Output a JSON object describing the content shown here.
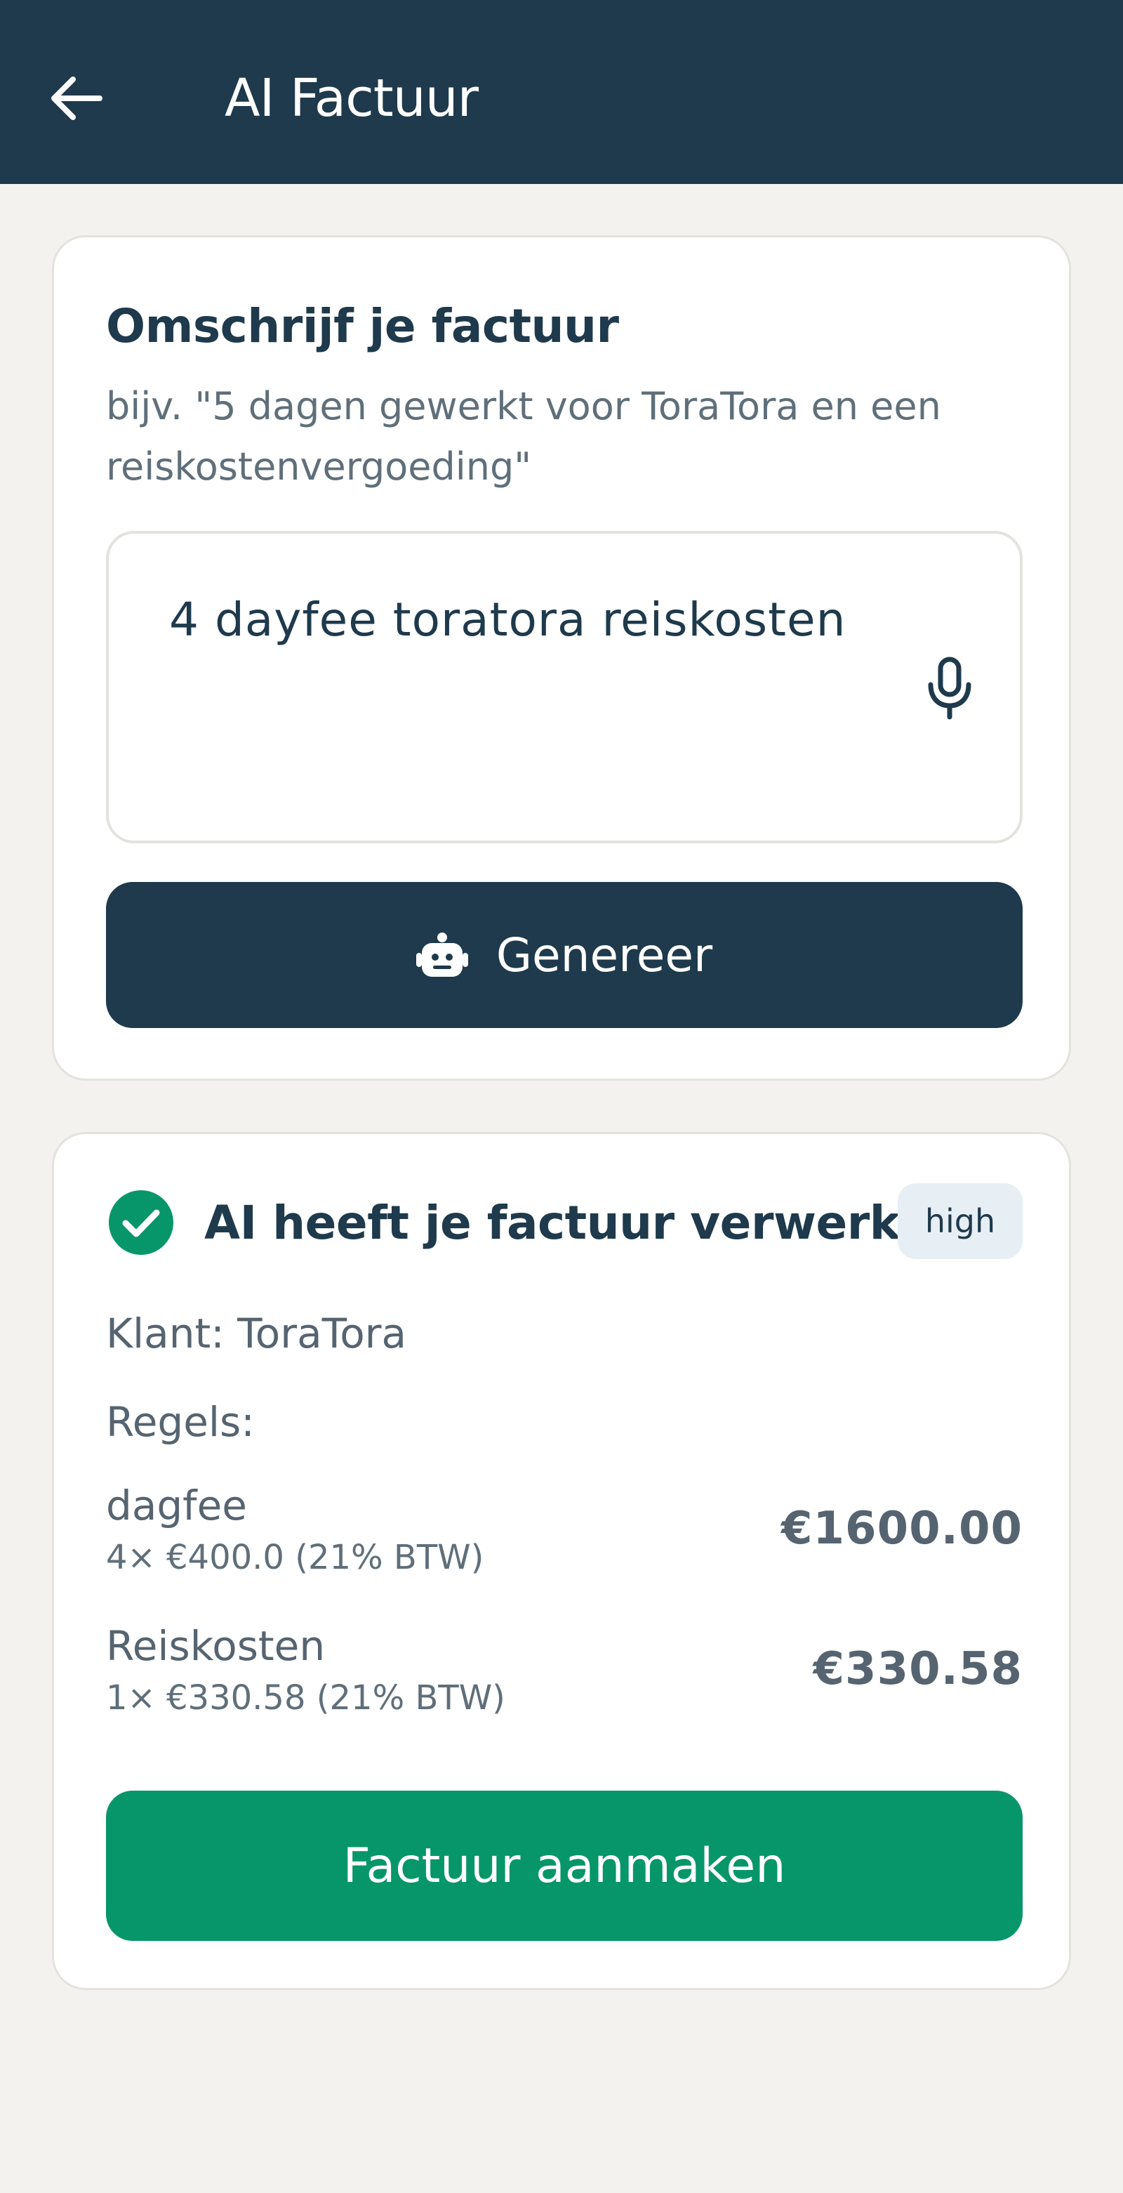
{
  "header": {
    "title": "AI Factuur",
    "back_icon": "arrow-left-icon"
  },
  "describe": {
    "title": "Omschrijf je factuur",
    "hint": "bijv. \"5 dagen gewerkt voor ToraTora en een reiskostenvergoeding\"",
    "prompt_value": "4 dayfee toratora reiskosten",
    "mic_icon": "microphone-icon",
    "generate_label": "Genereer",
    "generate_icon": "robot-icon"
  },
  "result": {
    "status_title": "AI heeft je factuur verwerkt",
    "status_icon": "check-circle-icon",
    "confidence": "high",
    "client": "Klant: ToraTora",
    "lines_label": "Regels:",
    "lines": [
      {
        "name": "dagfee",
        "detail": "4× €400.0 (21% BTW)",
        "amount": "€1600.00"
      },
      {
        "name": "Reiskosten",
        "detail": "1× €330.58 (21% BTW)",
        "amount": "€330.58"
      }
    ],
    "create_label": "Factuur aanmaken"
  },
  "colors": {
    "primary": "#1e3a4c",
    "success": "#07966a",
    "background": "#f3f2ef",
    "badge_bg": "#e7eff5"
  }
}
